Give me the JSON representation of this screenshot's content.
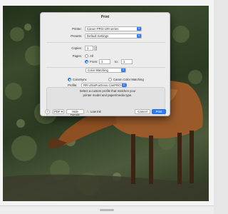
{
  "dialog": {
    "title": "Print",
    "printer_label": "Printer:",
    "printer_value": "Canon PRO-100 series",
    "presets_label": "Presets:",
    "presets_value": "Default Settings",
    "copies_label": "Copies:",
    "copies_value": "1",
    "pages_label": "Pages:",
    "pages_all": "All",
    "pages_from": "From:",
    "pages_from_value": "1",
    "pages_to": "to:",
    "pages_to_value": "1",
    "section_value": "Color Matching",
    "colorsync_label": "ColorSync",
    "canon_matching_label": "Canon Color Matching",
    "profile_label": "Profile:",
    "profile_value": "RR UltraProGloss CanPRO-100",
    "profile_note": "Select a custom profile that matches your printer model and paper/media type.",
    "help": "?",
    "pdf_button": "PDF",
    "hide_details_button": "Hide Details",
    "low_ink_label": "Low Ink",
    "cancel_button": "Cancel",
    "print_button": "Print"
  },
  "icons": {
    "popup_arrows": "⇕",
    "step_up": "▲",
    "step_down": "▼",
    "pdf_arrow": "▾",
    "warning": "⚠"
  }
}
